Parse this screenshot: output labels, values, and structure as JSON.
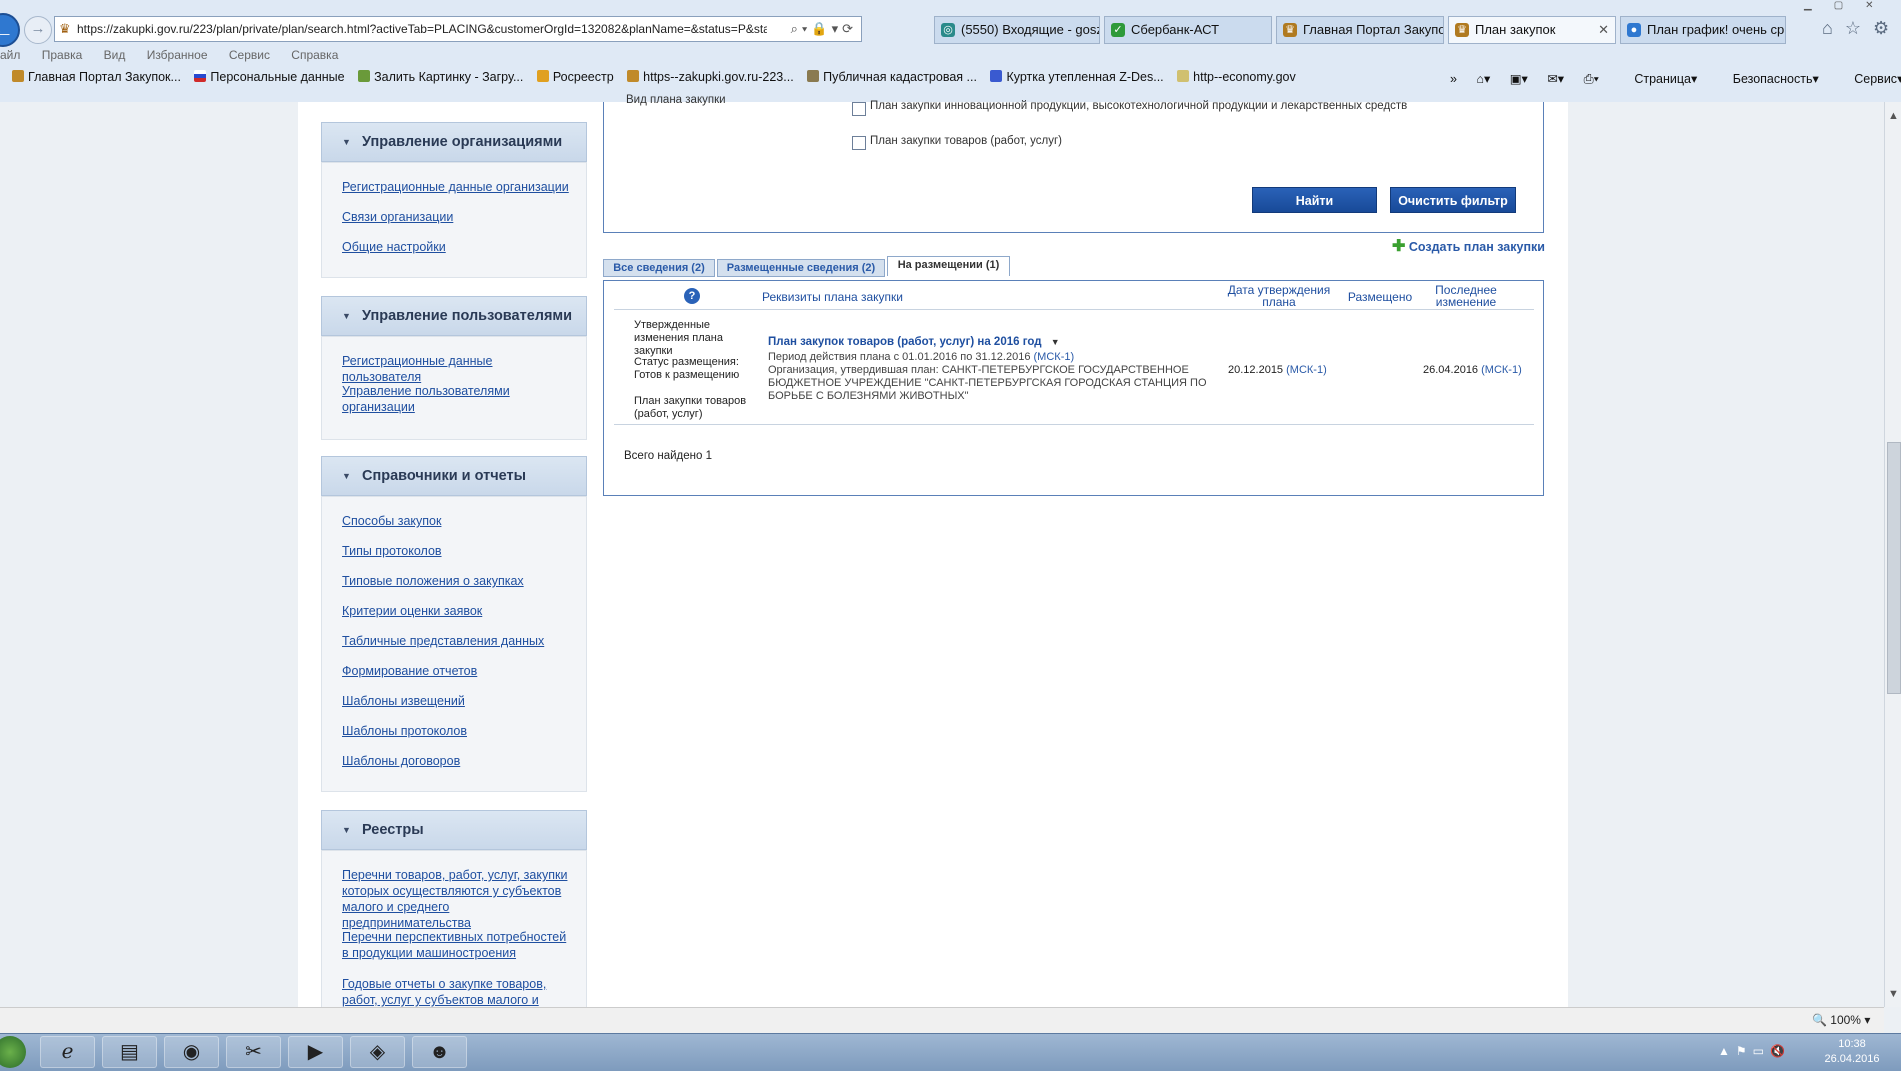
{
  "browser": {
    "url": "https://zakupki.gov.ru/223/plan/private/plan/search.html?activeTab=PLACING&customerOrgId=132082&planName=&status=P&status=M&status",
    "tabs": [
      {
        "label": "(5550) Входящие - gosza...",
        "active": false
      },
      {
        "label": "Сбербанк-АСТ",
        "active": false
      },
      {
        "label": "Главная Портал Закупок",
        "active": false
      },
      {
        "label": "План закупок",
        "active": true
      },
      {
        "label": "План график! очень ср...",
        "active": false
      }
    ],
    "menu": [
      "айл",
      "Правка",
      "Вид",
      "Избранное",
      "Сервис",
      "Справка"
    ],
    "favorites": [
      "Главная Портал Закупок...",
      "Персональные данные",
      "Залить Картинку - Загру...",
      "Росреестр",
      "https--zakupki.gov.ru-223...",
      "Публичная кадастровая ...",
      "Куртка утепленная Z-Des...",
      "http--economy.gov"
    ],
    "command_bar": [
      "Страница",
      "Безопасность",
      "Сервис"
    ],
    "zoom": "100%"
  },
  "sidebar": {
    "sections": [
      {
        "title": "Управление организациями",
        "links": [
          "Регистрационные данные организации",
          "Связи организации",
          "Общие настройки"
        ]
      },
      {
        "title": "Управление пользователями",
        "links": [
          "Регистрационные данные пользователя",
          "Управление пользователями организации"
        ]
      },
      {
        "title": "Справочники и отчеты",
        "links": [
          "Способы закупок",
          "Типы протоколов",
          "Типовые положения о закупках",
          "Критерии оценки заявок",
          "Табличные представления данных",
          "Формирование отчетов",
          "Шаблоны извещений",
          "Шаблоны протоколов",
          "Шаблоны договоров"
        ]
      },
      {
        "title": "Реестры",
        "links": [
          "Перечни товаров, работ, услуг, закупки которых осуществляются у субъектов малого и среднего предпринимательства",
          "Перечни перспективных потребностей в продукции машиностроения",
          "Годовые отчеты о закупке товаров, работ, услуг у субъектов малого и"
        ]
      }
    ]
  },
  "filter": {
    "plan_type_label": "Вид плана закупки",
    "options": [
      "План закупки инновационной продукции, высокотехнологичной продукции и лекарственных средств",
      "План закупки товаров (работ, услуг)"
    ],
    "find_button": "Найти",
    "clear_button": "Очистить фильтр",
    "create_link": "Создать план закупки"
  },
  "tabs": [
    {
      "label": "Все сведения (2)",
      "active": false
    },
    {
      "label": "Размещенные сведения (2)",
      "active": false
    },
    {
      "label": "На размещении (1)",
      "active": true
    }
  ],
  "results": {
    "headers": {
      "help": "?",
      "requisites": "Реквизиты плана закупки",
      "approval_date": "Дата утверждения плана",
      "placed": "Размещено",
      "last_change": "Последнее изменение"
    },
    "row": {
      "status_text": "Утвержденные изменения плана закупки",
      "placement_status": "Статус размещения: Готов к размещению",
      "plan_kind": "План закупки товаров (работ, услуг)",
      "title": "План закупок товаров (работ, услуг) на 2016 год",
      "period": "Период действия плана с 01.01.2016 по 31.12.2016",
      "period_tz": "(МСК-1)",
      "org": "Организация, утвердившая план:  САНКТ-ПЕТЕРБУРГСКОЕ ГОСУДАРСТВЕННОЕ БЮДЖЕТНОЕ УЧРЕЖДЕНИЕ \"САНКТ-ПЕТЕРБУРГСКАЯ ГОРОДСКАЯ СТАНЦИЯ ПО БОРЬБЕ С БОЛЕЗНЯМИ ЖИВОТНЫХ\"",
      "approval_date": "20.12.2015",
      "approval_tz": "(МСК-1)",
      "last_change": "26.04.2016",
      "last_change_tz": "(МСК-1)"
    },
    "total": "Всего найдено 1"
  },
  "taskbar": {
    "time": "10:38",
    "date": "26.04.2016"
  }
}
